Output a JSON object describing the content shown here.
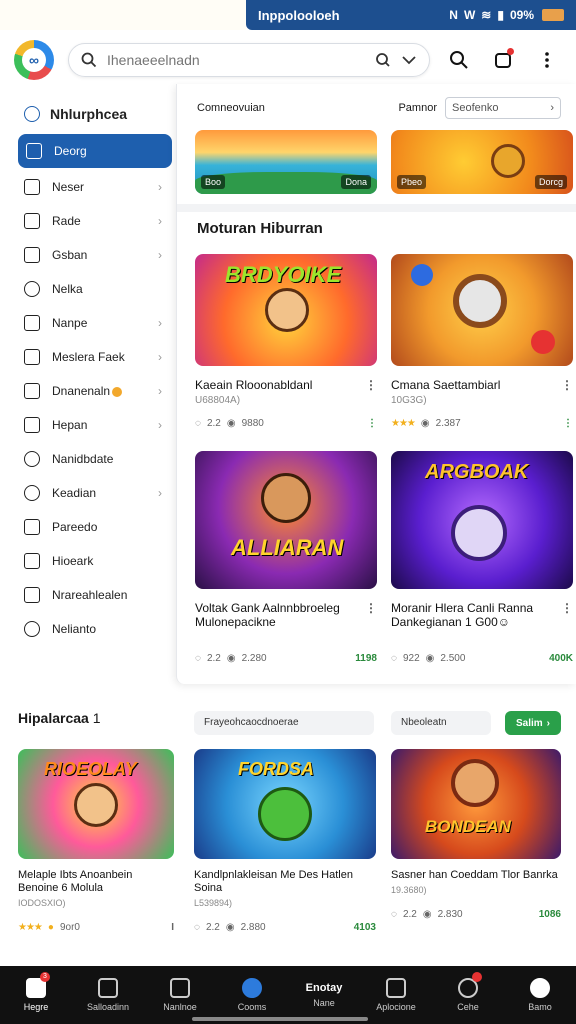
{
  "status_bar": {
    "title": "Inppolooloeh",
    "icons": [
      "N",
      "W",
      "wifi",
      "0",
      "6"
    ],
    "battery": "09%"
  },
  "topbar": {
    "search_placeholder": "Ihenaeeelnadn"
  },
  "sidebar": {
    "header": "Nhlurphcea",
    "items": [
      {
        "label": "Deorg",
        "icon": "folder-icon",
        "chevron": false,
        "active": true
      },
      {
        "label": "Neser",
        "icon": "home-icon",
        "chevron": true
      },
      {
        "label": "Rade",
        "icon": "document-icon",
        "chevron": true
      },
      {
        "label": "Gsban",
        "icon": "list-icon",
        "chevron": true
      },
      {
        "label": "Nelka",
        "icon": "chat-icon",
        "chevron": false
      },
      {
        "label": "Nanpe",
        "icon": "doc-icon",
        "chevron": true
      },
      {
        "label": "Meslera Faek",
        "icon": "edit-icon",
        "chevron": true
      },
      {
        "label": "Dnanenaln",
        "icon": "calendar-icon",
        "chevron": true,
        "warn": true
      },
      {
        "label": "Hepan",
        "icon": "shield-icon",
        "chevron": true
      },
      {
        "label": "Nanidbdate",
        "icon": "heart-icon",
        "chevron": false
      },
      {
        "label": "Keadian",
        "icon": "people-icon",
        "chevron": true
      },
      {
        "label": "Pareedo",
        "icon": "message-icon",
        "chevron": false
      },
      {
        "label": "Hioeark",
        "icon": "bookmark-icon",
        "chevron": false
      },
      {
        "label": "Nrareahlealen",
        "icon": "mail-icon",
        "chevron": false
      },
      {
        "label": "Nelianto",
        "icon": "settings-icon",
        "chevron": false
      }
    ]
  },
  "main": {
    "section_label": "Comneovuian",
    "sort_label": "Pamnor",
    "sort_value": "Seofenko",
    "banners": [
      {
        "left_tag": "Boo",
        "right_tag": "Dona"
      },
      {
        "left_tag": "Pbeo",
        "right_tag": "Dorcg"
      }
    ],
    "section_title": "Moturan Hiburran",
    "cards": [
      {
        "art_text": "BRDYOIKE",
        "title": "Kaeain Rlooonabldanl",
        "sub": "U68804A)",
        "stat1": "2.2",
        "stat2": "9880",
        "green": ""
      },
      {
        "art_text": "",
        "title": "Cmana Saettambiarl",
        "sub": "10G3G)",
        "stat1": "",
        "stat2": "2.387",
        "green": ""
      },
      {
        "art_text": "ALLIARAN",
        "title": "Voltak Gank Aalnnbbroeleg Mulonepacikne",
        "sub": "",
        "stat1": "2.2",
        "stat2": "2.280",
        "green": "1198"
      },
      {
        "art_text": "ARGBOAK",
        "title": "Moranir Hlera Canli Ranna Dankegianan 1 G00☺",
        "sub": "",
        "stat1": "922",
        "stat2": "2.500",
        "green": "400K"
      }
    ]
  },
  "lower": {
    "title": "Hipalarcaa",
    "count": "1",
    "pill1": "Frayeohcaocdnoerae",
    "pill2": "Nbeoleatn",
    "filter_label": "Salim",
    "cards": [
      {
        "art_text": "RIOEOLAY",
        "title": "Melaple Ibts Anoanbein Benoine 6 Molula",
        "sub": "IODOSXIO)",
        "stat1": "",
        "stat2": "9or0",
        "green": "I"
      },
      {
        "art_text": "FORDSA",
        "title": "Kandlpnlakleisan Me Des Hatlen Soina",
        "sub": "L539894)",
        "stat1": "2.2",
        "stat2": "2.880",
        "green": "4103"
      },
      {
        "art_text": "BONDEAN",
        "title": "Sasner han Coeddam Tlor Banrka",
        "sub": "19.3680)",
        "stat1": "2.2",
        "stat2": "2.830",
        "green": "1086"
      }
    ]
  },
  "bottom_nav": [
    {
      "label": "Hegre",
      "badge": "3",
      "active": true
    },
    {
      "label": "Salloadinn"
    },
    {
      "label": "Nanlnoe"
    },
    {
      "label": "Cooms"
    },
    {
      "label": "Nane",
      "top_label": "Enotay"
    },
    {
      "label": "Aplocione"
    },
    {
      "label": "Cehe",
      "badge": ""
    },
    {
      "label": "Bamo"
    }
  ]
}
